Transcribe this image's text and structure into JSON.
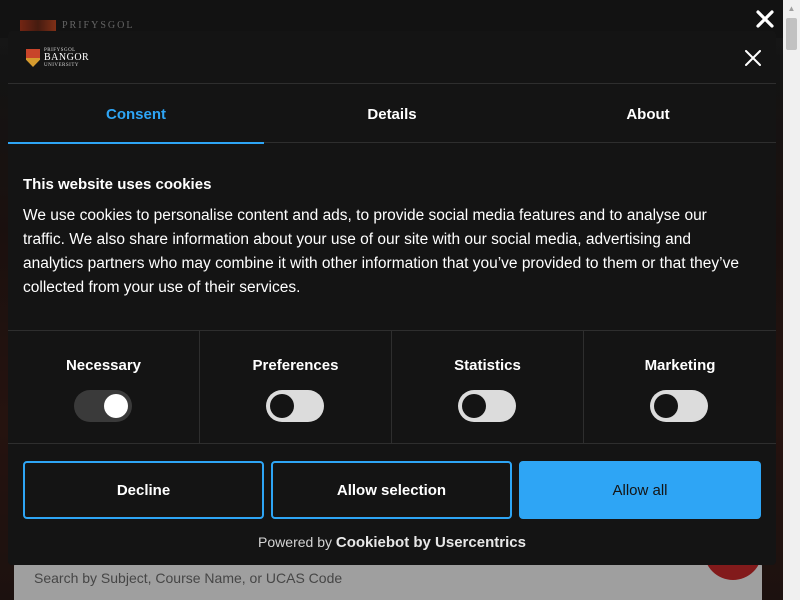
{
  "page": {
    "logo_text": "PRIFYSGOL",
    "search_placeholder": "Search by Subject, Course Name, or UCAS Code",
    "close_glyph": "✕"
  },
  "dialog": {
    "brand_small": "PRIFYSGOL",
    "brand_main": "BANGOR",
    "brand_sub": "UNIVERSITY",
    "close_glyph": "✕",
    "tabs": [
      {
        "label": "Consent",
        "active": true
      },
      {
        "label": "Details",
        "active": false
      },
      {
        "label": "About",
        "active": false
      }
    ],
    "heading": "This website uses cookies",
    "body": "We use cookies to personalise content and ads, to provide social media features and to analyse our traffic. We also share information about your use of our site with our social media, advertising and analytics partners who may combine it with other information that you’ve provided to them or that they’ve collected from your use of their services.",
    "toggles": [
      {
        "label": "Necessary",
        "checked": true
      },
      {
        "label": "Preferences",
        "checked": false
      },
      {
        "label": "Statistics",
        "checked": false
      },
      {
        "label": "Marketing",
        "checked": false
      }
    ],
    "buttons": {
      "decline": "Decline",
      "allow_selection": "Allow selection",
      "allow_all": "Allow all"
    },
    "powered_prefix": "Powered by",
    "powered_brand": "Cookiebot by Usercentrics"
  },
  "colors": {
    "accent": "#2ea5f5",
    "dialog_bg": "#141414",
    "brand_red": "#c8282a"
  }
}
